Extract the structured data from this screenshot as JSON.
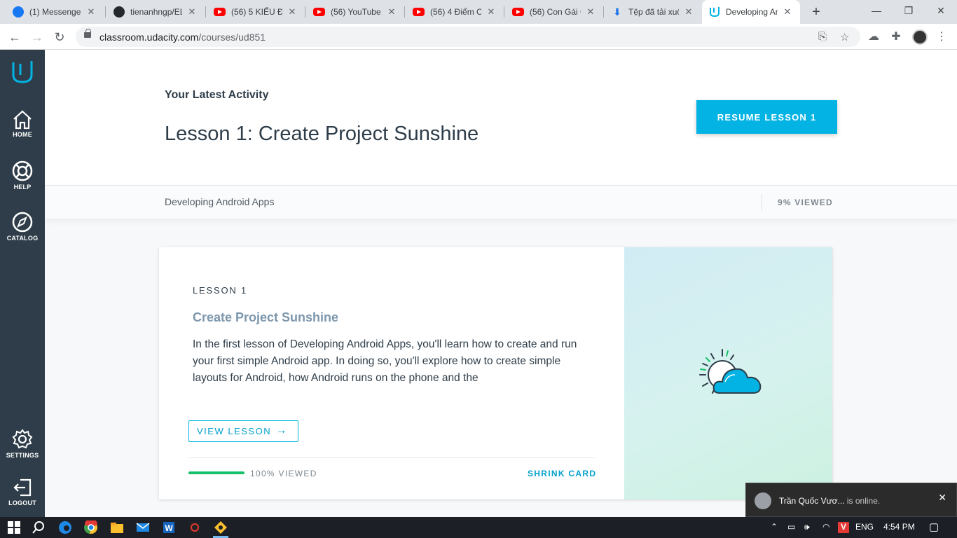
{
  "browser": {
    "tabs": [
      {
        "title": "(1) Messenger",
        "favicon": "facebook-icon"
      },
      {
        "title": "tienanhngp/EL",
        "favicon": "github-icon"
      },
      {
        "title": "(56) 5 KIỂU ĐỀ",
        "favicon": "youtube-icon"
      },
      {
        "title": "(56) YouTube",
        "favicon": "youtube-icon"
      },
      {
        "title": "(56) 4 Điểm CỦ",
        "favicon": "youtube-icon"
      },
      {
        "title": "(56) Con Gái G",
        "favicon": "youtube-icon"
      },
      {
        "title": "Tệp đã tải xuố",
        "favicon": "download-icon"
      },
      {
        "title": "Developing An",
        "favicon": "udacity-icon",
        "active": true
      }
    ],
    "url_host": "classroom.udacity.com",
    "url_path": "/courses/ud851"
  },
  "sidebar": {
    "items": [
      {
        "label": "HOME",
        "icon": "home-icon"
      },
      {
        "label": "HELP",
        "icon": "lifebuoy-icon"
      },
      {
        "label": "CATALOG",
        "icon": "compass-icon"
      },
      {
        "label": "SETTINGS",
        "icon": "gear-icon"
      },
      {
        "label": "LOGOUT",
        "icon": "logout-icon"
      }
    ]
  },
  "hero": {
    "eyebrow": "Your Latest Activity",
    "title": "Lesson 1: Create Project Sunshine",
    "resume_label": "RESUME LESSON 1"
  },
  "course": {
    "name": "Developing Android Apps",
    "progress_text": "9% VIEWED"
  },
  "card": {
    "lesson_number": "LESSON 1",
    "title": "Create Project Sunshine",
    "description": "In the first lesson of Developing Android Apps, you'll learn how to create and run your first simple Android app. In doing so, you'll explore how to create simple layouts for Android, how Android runs on the phone and the",
    "view_label": "VIEW LESSON",
    "viewed_text": "100% VIEWED",
    "viewed_fraction": 1.0,
    "shrink_label": "SHRINK CARD",
    "illustration": "sun-cloud-icon"
  },
  "chat": {
    "name": "Trần Quốc Vươ...",
    "status": "is online."
  },
  "taskbar": {
    "language": "ENG",
    "time": "4:54 PM"
  },
  "colors": {
    "sidebar": "#2e3d49",
    "accent": "#02b3e4",
    "progress": "#15c26b"
  }
}
